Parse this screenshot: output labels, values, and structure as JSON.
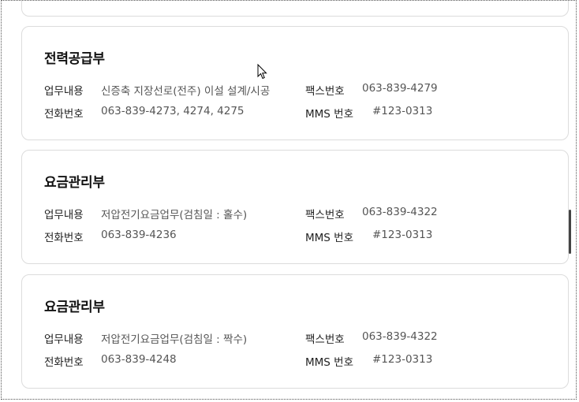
{
  "cards": [
    {
      "title": "전력공급부",
      "duty_label": "업무내용",
      "duty": "신증축 지장선로(전주) 이설 설계/시공",
      "phone_label": "전화번호",
      "phone": "063-839-4273, 4274, 4275",
      "fax_label": "팩스번호",
      "fax": "063-839-4279",
      "mms_label": "MMS 번호",
      "mms": "#123-0313"
    },
    {
      "title": "요금관리부",
      "duty_label": "업무내용",
      "duty": "저압전기요금업무(검침일 : 홀수)",
      "phone_label": "전화번호",
      "phone": "063-839-4236",
      "fax_label": "팩스번호",
      "fax": "063-839-4322",
      "mms_label": "MMS 번호",
      "mms": "#123-0313"
    },
    {
      "title": "요금관리부",
      "duty_label": "업무내용",
      "duty": "저압전기요금업무(검침일 : 짝수)",
      "phone_label": "전화번호",
      "phone": "063-839-4248",
      "fax_label": "팩스번호",
      "fax": "063-839-4322",
      "mms_label": "MMS 번호",
      "mms": "#123-0313"
    }
  ]
}
